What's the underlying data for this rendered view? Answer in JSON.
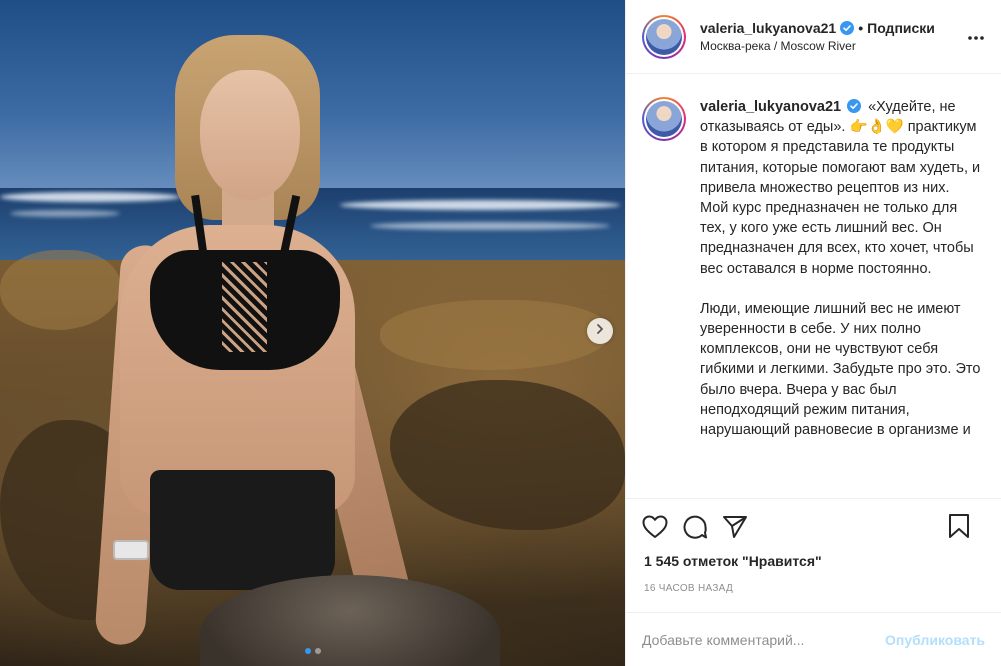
{
  "post": {
    "author": "valeria_lukyanova21",
    "follow_separator": "•",
    "follow_label": "Подписки",
    "location": "Москва-река / Moscow River",
    "more_icon": "more-horizontal-icon"
  },
  "caption": {
    "author": "valeria_lukyanova21",
    "line1": "«Худейте, не отказываясь от еды».",
    "emoji": "👉👌💛",
    "para1": "практикум в котором я представила те продукты питания, которые помогают вам худеть, и привела множество рецептов из них.",
    "para2": "Мой курс предназначен не только для тех, у кого уже есть лишний вес. Он предназначен для всех, кто хочет, чтобы вес оставался в норме постоянно.",
    "para3": "Люди, имеющие лишний вес не имеют уверенности в себе. У них полно комплексов, они не чувствуют себя гибкими и легкими. Забудьте про это. Это было вчера. Вчера у вас был неподходящий режим питания, нарушающий равновесие в организме и"
  },
  "actions": {
    "like_icon": "heart-icon",
    "comment_icon": "comment-icon",
    "share_icon": "send-icon",
    "save_icon": "bookmark-icon"
  },
  "likes_text": "1 545 отметок \"Нравится\"",
  "time_text": "16 часов назад",
  "comment_box": {
    "placeholder": "Добавьте комментарий...",
    "publish_label": "Опубликовать"
  },
  "carousel": {
    "count": 2,
    "active": 1
  },
  "colors": {
    "accent": "#3897f0",
    "publish_disabled": "#b2dffc",
    "verified": "#3897f0"
  }
}
